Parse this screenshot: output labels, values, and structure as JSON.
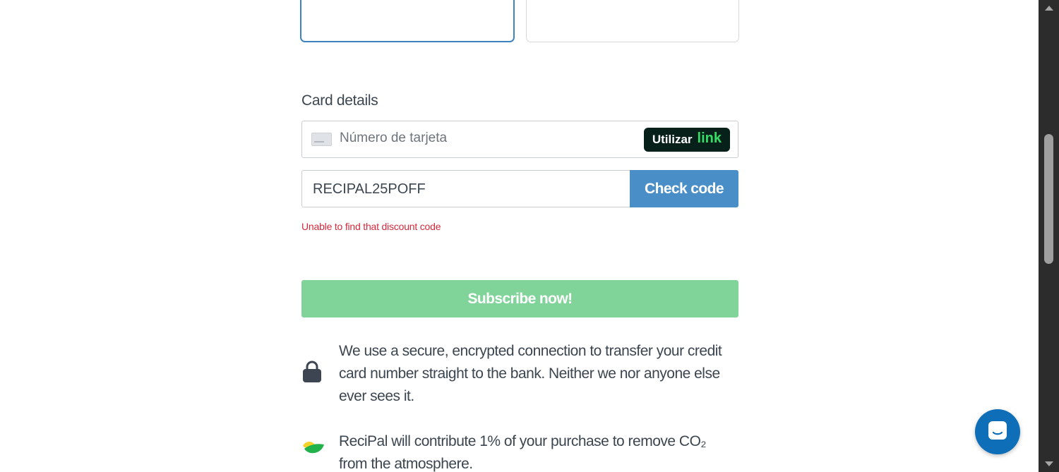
{
  "checkout": {
    "section_label": "Card details",
    "card_number_placeholder": "Número de tarjeta",
    "link_button": {
      "use_label": "Utilizar",
      "brand_label": "link"
    },
    "discount_code_value": "RECIPAL25POFF",
    "check_code_label": "Check code",
    "error_message": "Unable to find that discount code",
    "subscribe_label": "Subscribe now!",
    "secure_note": "We use a secure, encrypted connection to transfer your credit card number straight to the bank. Neither we nor anyone else ever sees it.",
    "climate_note": "ReciPal will contribute 1% of your purchase to remove CO₂ from the atmosphere."
  },
  "icons": {
    "card": "credit-card-icon",
    "lock": "lock-icon",
    "leaf": "leaf-icon",
    "chat": "chat-icon"
  },
  "colors": {
    "accent_blue": "#4a8ec8",
    "selected_border": "#3d83c0",
    "subscribe_green": "#80d49a",
    "error_red": "#d4283b",
    "link_dark": "#07201a",
    "link_green": "#33dd66",
    "chat_blue": "#0e6eb8"
  }
}
